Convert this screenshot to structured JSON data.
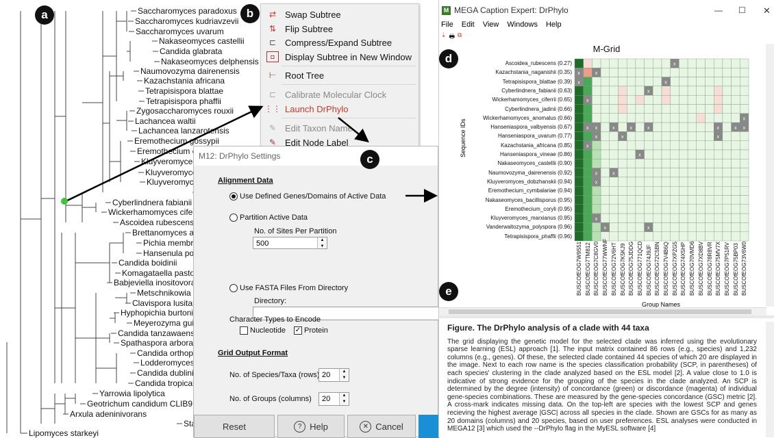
{
  "badges": {
    "a": "a",
    "b": "b",
    "c": "c",
    "d": "d",
    "e": "e"
  },
  "tree": {
    "taxa": [
      "Saccharomyces paradoxus",
      "Saccharomyces kudriavzevii",
      "Saccharomyces uvarum",
      "Nakaseomyces castellii",
      "Candida glabrata",
      "Nakaseomyces delphensis",
      "Naumovozyma dairenensis",
      "Kazachstania africana",
      "Tetrapisispora blattae",
      "Tetrapisispora phaffii",
      "Zygosaccharomyces rouxii",
      "Lachancea waltii",
      "Lachancea lanzarotensis",
      "Eremothecium gossypii",
      "Eremothecium cy",
      "Kluyveromyces a",
      "Kluyveromyces",
      "Kluyveromyces",
      "H",
      "Cyberlindnera fabianii",
      "Wickerhamomyces ciferrii",
      "Ascoidea rubescens",
      "Brettanomyces a",
      "Pichia membran",
      "Hansenula polymorph",
      "Candida boidinii",
      "Komagataella pastoris",
      "Babjeviella inositovora",
      "Metschnikowia fru",
      "Clavispora lusitania",
      "Hyphopichia burtonii",
      "Meyerozyma guilliern",
      "Candida tanzawaensis",
      "Spathaspora arbora",
      "Candida orthopsi",
      "Lodderomyces e",
      "Candida dubliniens",
      "Candida tropicalis",
      "Yarrowia lipolytica",
      "Geotrichum candidum CLIB918",
      "Arxula adeninivorans",
      "Starmerella bor",
      "Lipomyces starkeyi"
    ]
  },
  "context_menu": {
    "items": [
      "Swap Subtree",
      "Flip Subtree",
      "Compress/Expand Subtree",
      "Display Subtree in New Window",
      "Root Tree",
      "Calibrate Molecular Clock",
      "Launch DrPhylo",
      "Edit Taxon Name",
      "Edit Node Label"
    ]
  },
  "settings_dialog": {
    "title": "M12: DrPhylo Settings",
    "alignment_header": "Alignment Data",
    "opt_defined": "Use Defined Genes/Domains of Active Data",
    "opt_partition": "Partition Active Data",
    "sites_label": "No. of Sites Per Partition",
    "sites_value": "500",
    "opt_fasta": "Use FASTA Files From Directory",
    "directory_label": "Directory:",
    "directory_value": "",
    "char_types_label": "Character Types to Encode",
    "nucleotide": "Nucleotide",
    "protein": "Protein",
    "grid_header": "Grid Output Format",
    "rows_label": "No. of Species/Taxa (rows)",
    "rows_value": "20",
    "cols_label": "No. of Groups (columns)",
    "cols_value": "20",
    "reset": "Reset",
    "help": "Help",
    "cancel": "Cancel"
  },
  "mega_window": {
    "title": "MEGA Caption Expert: DrPhylo",
    "menu": [
      "File",
      "Edit",
      "View",
      "Windows",
      "Help"
    ],
    "grid_title": "M-Grid",
    "y_axis": "Sequence IDs",
    "x_axis": "Group Names",
    "rows": [
      "Ascoidea_rubescens (0.27)",
      "Kazachstania_naganishii (0.35)",
      "Tetrapisispora_blattae (0.39)",
      "Cyberlindnera_fabianii (0.63)",
      "Wickerhamomyces_ciferrii (0.65)",
      "Cyberlindnera_jadinii (0.66)",
      "Wickerhamomyces_anomalus (0.66)",
      "Hanseniaspora_valbyensis (0.67)",
      "Hanseniaspora_uvarum (0.77)",
      "Kazachstania_africana (0.85)",
      "Hanseniaspora_vineae (0.86)",
      "Nakaseomyces_castellii (0.90)",
      "Naumovozyma_dairenensis (0.92)",
      "Kluyveromyces_dobzhanskii (0.94)",
      "Eremothecium_cymbalariae (0.94)",
      "Nakaseomyces_bacillisporus (0.95)",
      "Eremothecium_coryli (0.95)",
      "Kluyveromyces_marxianus (0.95)",
      "Vanderwaltozyma_polyspora (0.96)",
      "Tetrapisispora_phaffii (0.96)"
    ],
    "columns": [
      "BUSCOfEOG7W9S51",
      "BUSCOfEOG7TM812",
      "BUSCOfEOG7C8GV0",
      "BUSCOfEOG77WWNF",
      "BUSCOfEOG72V6HT",
      "BUSCOfEOG7K5KJ9",
      "BUSCOfEOG75JDDG",
      "BUSCOfEOG771QCD",
      "BUSCOfEOG74J9JF",
      "BUSCOfEOG72C5BN",
      "BUSCOfEOG7V4B6Q",
      "BUSCOfEOG7XPZG5",
      "BUSCOfEOG74X5HP",
      "BUSCOfEOG70VMD6",
      "BUSCOfEOG7XD8BV",
      "BUSCOfEOG78R8VR",
      "BUSCOfEOG75MV7X",
      "BUSCOfEOG7P51RV",
      "BUSCOfEOG75BP03",
      "BUSCOfEOG73V6W0"
    ],
    "caption_title": "Figure. The DrPhylo analysis of a clade with 44 taxa",
    "caption_text": "The grid displaying the genetic model for the selected clade was inferred using the evolutionary sparse learning (ESL) approach [1]. The input matrix contained 86 rows (e.g., species) and 1,232 columns (e.g., genes). Of these, the selected clade contained 44 species of which 20 are displayed in the image. Next to each row name is the species classification probability (SCP, in parentheses) of each species' clustering in the clade analyzed based on the ESL model [2]. A value close to 1.0 is indicative of strong evidence for the grouping of the species in the clade analyzed. An SCP is determined by the degree (intensity) of concordance (green) or discordance (magenta) of individual gene-species combinations. These are measured by the gene-species concordance (GSC) metric [2]. A cross-mark indicates missing data. On the top-left are species with the lowest SCP and genes recieving the highest average |GSC| across all species in the clade. Shown are GSCs for as many as 20 domains (columns) and 20 species, based on user preferences. ESL analyses were conducted in MEGA12 [3] which used the --DrPhylo flag in the MyESL software [4]",
    "colors": {
      "concordance": "#2e8b3a",
      "discordance": "#e8a08a",
      "missing": "#888888",
      "light": "#e8f5e4"
    }
  }
}
